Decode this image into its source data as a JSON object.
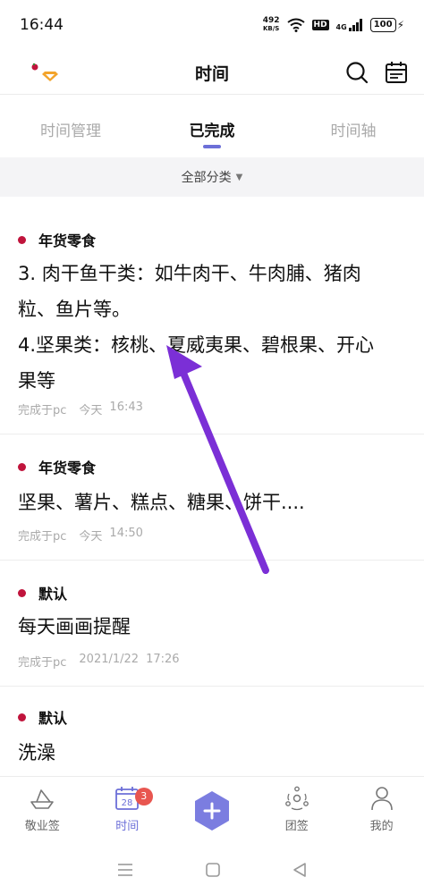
{
  "status_bar": {
    "time": "16:44",
    "net_speed_value": "492",
    "net_speed_unit": "KB/S",
    "hd_label": "HD",
    "signal_label": "4G",
    "battery": "100"
  },
  "header": {
    "title": "时间"
  },
  "tabs": [
    {
      "label": "时间管理",
      "active": false
    },
    {
      "label": "已完成",
      "active": true
    },
    {
      "label": "时间轴",
      "active": false
    }
  ],
  "filter": {
    "label": "全部分类"
  },
  "notes": [
    {
      "category": "年货零食",
      "lines": [
        "3.  肉干鱼干类：如牛肉干、牛肉脯、猪肉",
        "粒、鱼片等。",
        "4.坚果类：核桃、夏威夷果、碧根果、开心",
        "果等"
      ],
      "source": "完成于pc",
      "date": "今天",
      "time": "16:43"
    },
    {
      "category": "年货零食",
      "lines": [
        "坚果、薯片、糕点、糖果、饼干...."
      ],
      "source": "完成于pc",
      "date": "今天",
      "time": "14:50"
    },
    {
      "category": "默认",
      "lines": [
        "每天画画提醒"
      ],
      "source": "完成于pc",
      "date": "2021/1/22",
      "time": "17:26"
    },
    {
      "category": "默认",
      "lines": [
        "洗澡"
      ]
    }
  ],
  "bottom_nav": [
    {
      "label": "敬业签",
      "icon": "boat-icon",
      "active": false
    },
    {
      "label": "时间",
      "icon": "calendar-icon",
      "active": true,
      "badge": "3",
      "calendar_day": "28"
    },
    {
      "label": "",
      "icon": "add-icon",
      "active": false
    },
    {
      "label": "团签",
      "icon": "group-icon",
      "active": false
    },
    {
      "label": "我的",
      "icon": "profile-icon",
      "active": false
    }
  ],
  "colors": {
    "accent": "#6c6fd8",
    "category_dot": "#c0143c",
    "arrow": "#7b2fd6",
    "badge": "#e85650"
  }
}
